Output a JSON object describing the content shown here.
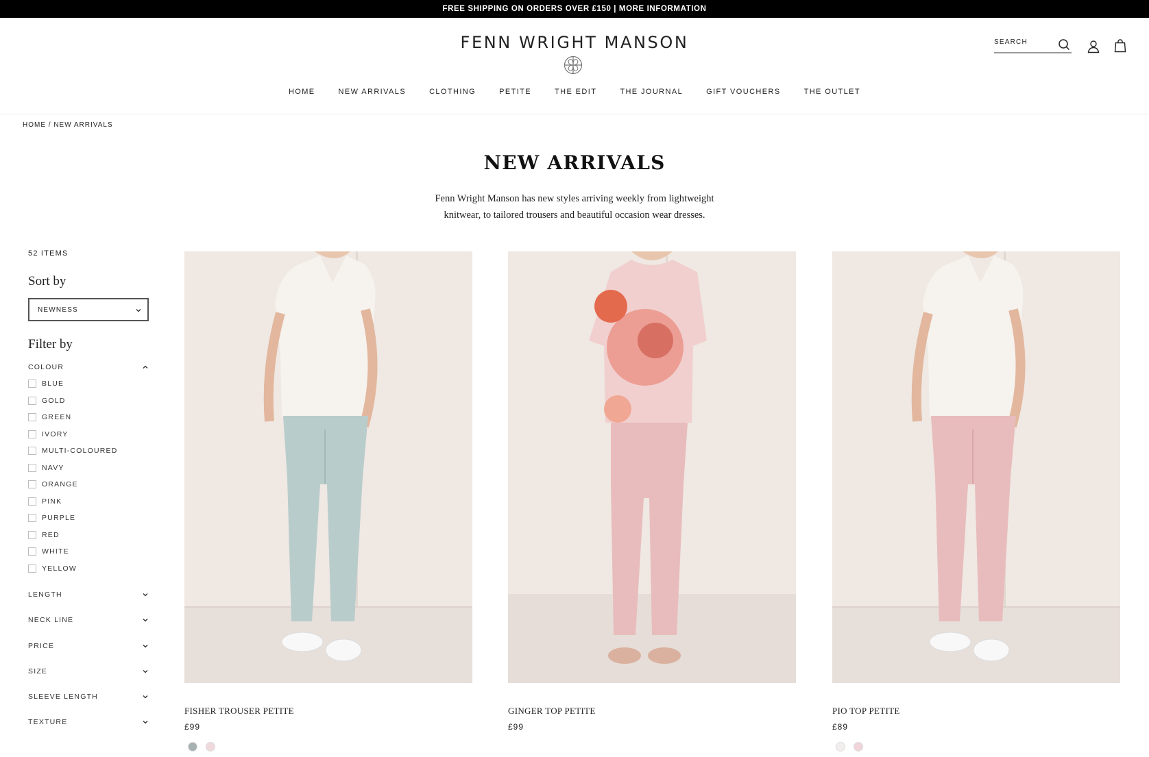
{
  "promo": {
    "text": "FREE SHIPPING ON ORDERS OVER £150 | MORE INFORMATION"
  },
  "header": {
    "logo_text": "FENN WRIGHT MANSON",
    "search_label": "SEARCH",
    "icons": [
      "search-icon",
      "account-icon",
      "bag-icon"
    ]
  },
  "nav": {
    "items": [
      "HOME",
      "NEW ARRIVALS",
      "CLOTHING",
      "PETITE",
      "THE EDIT",
      "THE JOURNAL",
      "GIFT VOUCHERS",
      "THE OUTLET"
    ]
  },
  "breadcrumb": {
    "text": "HOME / NEW ARRIVALS"
  },
  "page": {
    "title": "NEW ARRIVALS",
    "intro": "Fenn Wright Manson has new styles arriving weekly from lightweight knitwear, to tailored trousers and beautiful occasion wear dresses."
  },
  "sidebar": {
    "items_count": "52 ITEMS",
    "sort_heading": "Sort by",
    "sort_value": "NEWNESS",
    "filter_heading": "Filter by",
    "colour_title": "COLOUR",
    "colours": [
      "BLUE",
      "GOLD",
      "GREEN",
      "IVORY",
      "MULTI-COLOURED",
      "NAVY",
      "ORANGE",
      "PINK",
      "PURPLE",
      "RED",
      "WHITE",
      "YELLOW"
    ],
    "filters": [
      "LENGTH",
      "NECK LINE",
      "PRICE",
      "SIZE",
      "SLEEVE LENGTH",
      "TEXTURE"
    ]
  },
  "products": [
    {
      "name": "FISHER TROUSER PETITE",
      "price": "£99",
      "swatches": [
        "#a7b1b1",
        "#efd9dd"
      ]
    },
    {
      "name": "GINGER TOP PETITE",
      "price": "£99",
      "swatches": []
    },
    {
      "name": "PIO TOP PETITE",
      "price": "£89",
      "swatches": [
        "#f3eeee",
        "#efd4da"
      ]
    }
  ],
  "colors": {
    "promo_bg": "#000000",
    "image_bg": "#ebe3de",
    "trouser_blue": "#b9cccc",
    "trouser_pink": "#e8bcbc",
    "top_white": "#f6f2ee"
  }
}
